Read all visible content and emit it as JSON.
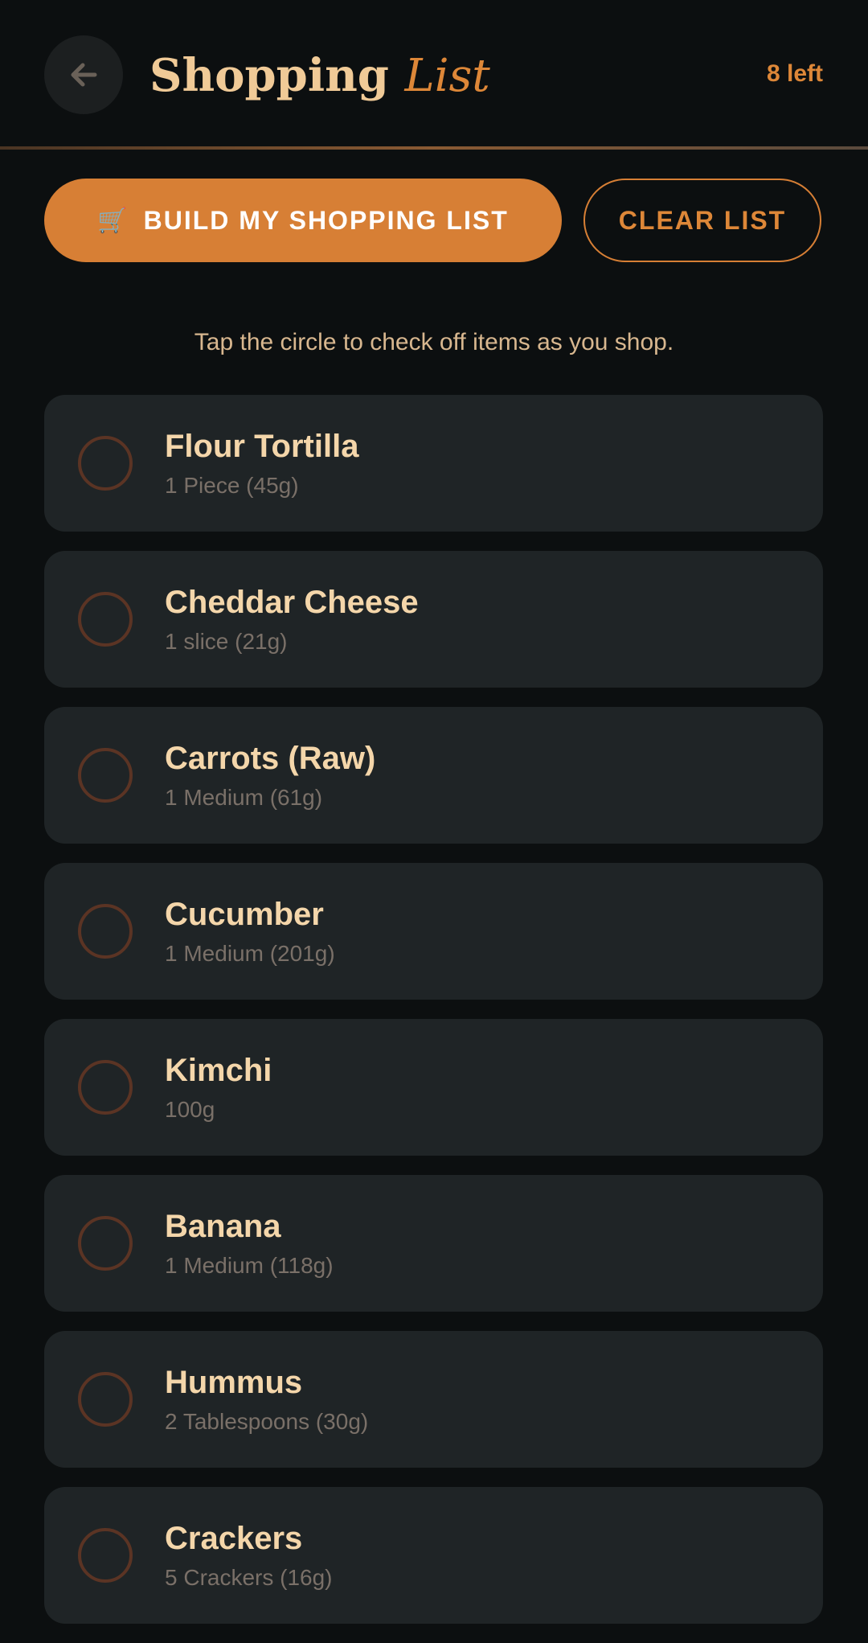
{
  "header": {
    "title_main": "Shopping",
    "title_accent": "List",
    "count": "8 left",
    "back_icon": "arrow-left-icon"
  },
  "actions": {
    "build_icon": "🛒",
    "build_label": "BUILD MY SHOPPING LIST",
    "clear_label": "CLEAR LIST"
  },
  "hint": "Tap the circle to check off items as you shop.",
  "items": [
    {
      "name": "Flour Tortilla",
      "qty": "1 Piece (45g)",
      "checked": false
    },
    {
      "name": "Cheddar Cheese",
      "qty": "1 slice (21g)",
      "checked": false
    },
    {
      "name": "Carrots (Raw)",
      "qty": "1 Medium (61g)",
      "checked": false
    },
    {
      "name": "Cucumber",
      "qty": "1 Medium (201g)",
      "checked": false
    },
    {
      "name": "Kimchi",
      "qty": "100g",
      "checked": false
    },
    {
      "name": "Banana",
      "qty": "1 Medium (118g)",
      "checked": false
    },
    {
      "name": "Hummus",
      "qty": "2 Tablespoons (30g)",
      "checked": false
    },
    {
      "name": "Crackers",
      "qty": "5 Crackers (16g)",
      "checked": false
    }
  ],
  "colors": {
    "background": "#0c0f10",
    "card": "#1f2426",
    "accent": "#d77f35",
    "title": "#f0ca97",
    "check_ring": "#5b3424"
  }
}
